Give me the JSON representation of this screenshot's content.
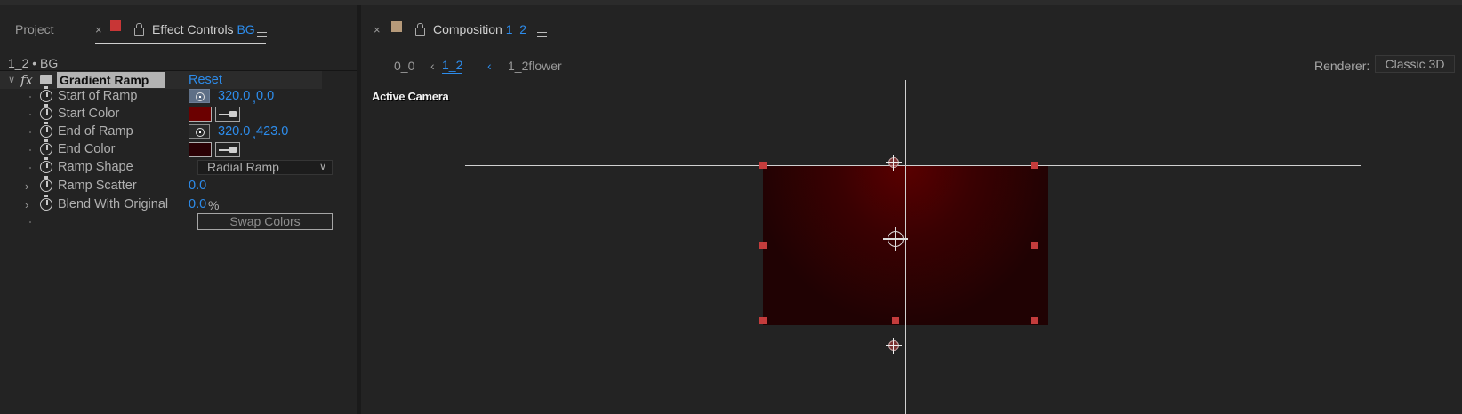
{
  "left_panel": {
    "tab_project": "Project",
    "tab_effect_controls": "Effect Controls",
    "tab_effect_layer": "BG",
    "breadcrumb": "1_2 • BG",
    "effect": {
      "name": "Gradient Ramp",
      "reset": "Reset",
      "fx": "fx",
      "properties": {
        "start_of_ramp": {
          "label": "Start of Ramp",
          "x": "320.0",
          "sep": ",",
          "y": "0.0"
        },
        "start_color": {
          "label": "Start Color",
          "color": "#6b0000"
        },
        "end_of_ramp": {
          "label": "End of Ramp",
          "x": "320.0",
          "sep": ",",
          "y": "423.0"
        },
        "end_color": {
          "label": "End Color",
          "color": "#2a0004"
        },
        "ramp_shape": {
          "label": "Ramp Shape",
          "value": "Radial Ramp"
        },
        "ramp_scatter": {
          "label": "Ramp Scatter",
          "value": "0.0"
        },
        "blend_with_original": {
          "label": "Blend With Original",
          "value": "0.0",
          "unit": "%"
        },
        "swap_colors": "Swap Colors"
      }
    },
    "label_color": "#c83636"
  },
  "right_panel": {
    "tab_composition": "Composition",
    "tab_comp_name": "1_2",
    "label_color": "#b69a7a",
    "nav": {
      "item0": "0_0",
      "item1": "1_2",
      "item2": "1_2flower",
      "renderer_label": "Renderer:",
      "renderer_value": "Classic 3D"
    },
    "viewer": {
      "camera": "Active Camera"
    }
  }
}
